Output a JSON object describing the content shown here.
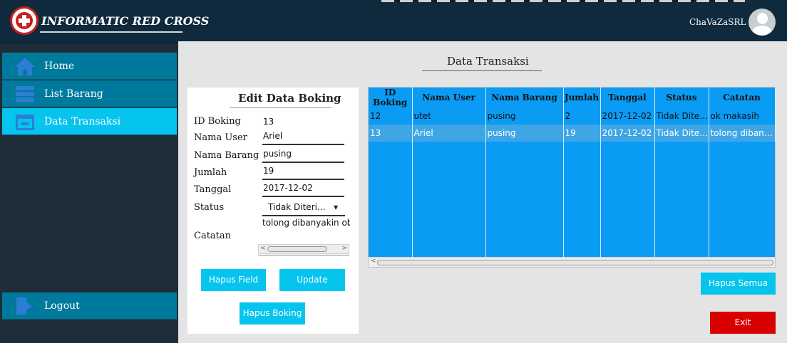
{
  "header": {
    "brand": "INFORMATIC RED CROSS",
    "username": "ChaVaZaSRL"
  },
  "sidebar": {
    "items": [
      {
        "label": "Home",
        "icon": "home-icon"
      },
      {
        "label": "List Barang",
        "icon": "list-icon"
      },
      {
        "label": "Data Transaksi",
        "icon": "folder-icon",
        "active": true
      }
    ],
    "logout": "Logout"
  },
  "main": {
    "title": "Data Transaksi"
  },
  "edit": {
    "title": "Edit Data Boking",
    "labels": {
      "id": "ID Boking",
      "user": "Nama User",
      "barang": "Nama Barang",
      "jumlah": "Jumlah",
      "tanggal": "Tanggal",
      "status": "Status",
      "catatan": "Catatan"
    },
    "values": {
      "id": "13",
      "user": "Ariel",
      "barang": "pusing",
      "jumlah": "19",
      "tanggal": "2017-12-02",
      "status": "Tidak Diteri...",
      "catatan": "tolong dibanyakin obat"
    },
    "buttons": {
      "hapus_field": "Hapus Field",
      "update": "Update",
      "hapus_boking": "Hapus Boking"
    }
  },
  "table": {
    "headers": [
      "ID Boking",
      "Nama User",
      "Nama Barang",
      "Jumlah",
      "Tanggal",
      "Status",
      "Catatan"
    ],
    "rows": [
      [
        "12",
        "utet",
        "pusing",
        "2",
        "2017-12-02",
        "Tidak Diteri...",
        "ok makasih"
      ],
      [
        "13",
        "Ariel",
        "pusing",
        "19",
        "2017-12-02",
        "Tidak Diter...",
        "tolong dibany..."
      ]
    ]
  },
  "actions": {
    "hapus_semua": "Hapus Semua",
    "exit": "Exit"
  },
  "colors": {
    "accent": "#05c4ee",
    "nav": "#007a9c",
    "header": "#0f2a3c",
    "table": "#0a9bf5",
    "exit": "#d90000"
  }
}
